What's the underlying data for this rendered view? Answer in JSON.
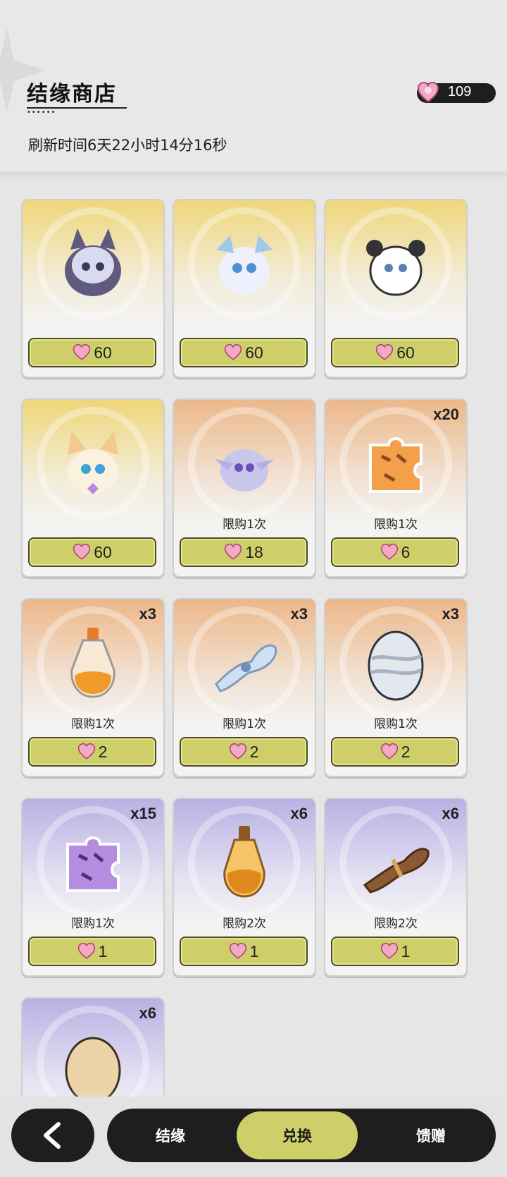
{
  "header": {
    "title": "结缘商店",
    "currency_amount": "109",
    "refresh_text": "刷新时间6天22小时14分16秒"
  },
  "items": [
    {
      "qty": "",
      "limit": "",
      "price": "60",
      "art": "cat-pet-icon"
    },
    {
      "qty": "",
      "limit": "",
      "price": "60",
      "art": "dragon-pet-icon"
    },
    {
      "qty": "",
      "limit": "",
      "price": "60",
      "art": "panda-pet-icon"
    },
    {
      "qty": "",
      "limit": "",
      "price": "60",
      "art": "fox-pet-icon"
    },
    {
      "qty": "",
      "limit": "限购1次",
      "price": "18",
      "art": "deer-pet-icon"
    },
    {
      "qty": "x20",
      "limit": "限购1次",
      "price": "6",
      "art": "puzzle-piece-icon"
    },
    {
      "qty": "x3",
      "limit": "限购1次",
      "price": "2",
      "art": "potion-bottle-icon"
    },
    {
      "qty": "x3",
      "limit": "限购1次",
      "price": "2",
      "art": "cloth-bundle-icon"
    },
    {
      "qty": "x3",
      "limit": "限购1次",
      "price": "2",
      "art": "striped-egg-icon"
    },
    {
      "qty": "x15",
      "limit": "限购1次",
      "price": "1",
      "art": "purple-puzzle-icon"
    },
    {
      "qty": "x6",
      "limit": "限购2次",
      "price": "1",
      "art": "amber-potion-icon"
    },
    {
      "qty": "x6",
      "limit": "限购2次",
      "price": "1",
      "art": "rope-bundle-icon"
    },
    {
      "qty": "x6",
      "limit": "",
      "price": "",
      "art": "plain-egg-icon"
    }
  ],
  "nav": {
    "tabs": [
      "结缘",
      "兑换",
      "馈赠"
    ],
    "active_tab": "兑换"
  },
  "colors": {
    "button": "#cfcf6a",
    "dark_bar": "#1e1e1e"
  }
}
